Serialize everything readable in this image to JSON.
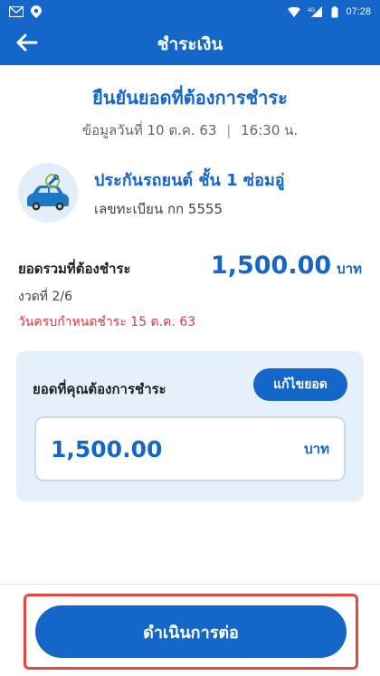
{
  "status_bar": {
    "time": "07:28",
    "network_label": "4G",
    "icons": [
      "gmail-icon",
      "notification-icon",
      "wifi-icon",
      "signal-icon",
      "battery-icon"
    ]
  },
  "app_bar": {
    "title": "ชำระเงิน",
    "back_icon": "arrow-left-icon"
  },
  "confirm": {
    "title": "ยืนยันยอดที่ต้องการชำระ",
    "date_text": "ข้อมูลวันที่ 10 ต.ค. 63",
    "separator": "|",
    "time_text": "16:30 น."
  },
  "product": {
    "icon": "car-repair-icon",
    "name": "ประกันรถยนต์ ชั้น 1 ซ่อมอู่",
    "plate": "เลขทะเบียน กก 5555"
  },
  "summary": {
    "total_label": "ยอดรวมที่ต้องชำระ",
    "total_amount": "1,500.00",
    "currency": "บาท",
    "installment": "งวดที่ 2/6",
    "due_date": "วันครบกำหนดชำระ 15 ต.ค. 63"
  },
  "payment": {
    "label": "ยอดที่คุณต้องการชำระ",
    "edit_label": "แก้ไขยอด",
    "amount": "1,500.00",
    "currency": "บาท"
  },
  "footer": {
    "continue_label": "ดำเนินการต่อ"
  },
  "colors": {
    "primary": "#1466c8",
    "alert": "#e0353a",
    "highlight": "#e8473f",
    "card_bg": "#e6f0fb"
  }
}
